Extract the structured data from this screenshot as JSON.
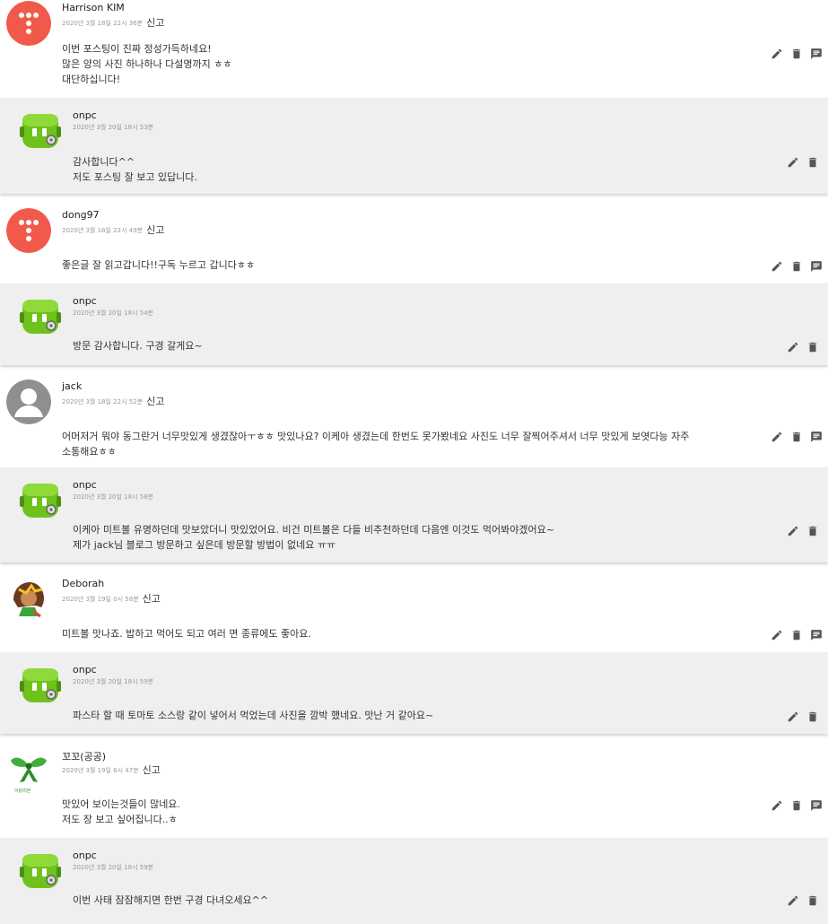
{
  "labels": {
    "report": "신고"
  },
  "threads": [
    {
      "comment": {
        "author": "Harrison KIM",
        "date": "2020년 3월 18일 22시 36분",
        "lines": [
          "이번 포스팅이 진짜 정성가득하네요!",
          "많은 양의 사진 하나하나 다설명까지 ㅎㅎ",
          "대단하십니다!"
        ],
        "avatar": "tistory-logo-avatar"
      },
      "reply": {
        "author": "onpc",
        "date": "2020년 3월 20일 18시 53분",
        "lines": [
          "감사합니다^^",
          "저도 포스팅 잘 보고 있답니다."
        ],
        "avatar": "green-robot-avatar"
      }
    },
    {
      "comment": {
        "author": "dong97",
        "date": "2020년 3월 18일 22시 49분",
        "lines": [
          "좋은글 잘 읽고갑니다!!구독 누르고 갑니다ㅎㅎ"
        ],
        "avatar": "tistory-logo-avatar"
      },
      "reply": {
        "author": "onpc",
        "date": "2020년 3월 20일 18시 54분",
        "lines": [
          "방문 감사합니다. 구경 갈게요~"
        ],
        "avatar": "green-robot-avatar"
      }
    },
    {
      "comment": {
        "author": "jack",
        "date": "2020년 3월 18일 22시 52분",
        "lines": [
          "어머저거 뭐야 동그란거 너무맛있게 생겼잖아ㅜㅎㅎ 맛있나요? 이케아 생겼는데 한번도 못가봤네요 사진도 너무 잘찍어주셔서 너무 맛있게 보엿다능 자주",
          "소통해요ㅎㅎ"
        ],
        "avatar": "default-user-avatar"
      },
      "reply": {
        "author": "onpc",
        "date": "2020년 3월 20일 18시 58분",
        "lines": [
          "이케아 미트볼 유명하던데 맛보았더니 맛있었어요. 비건 미트볼은 다들 비추천하던데 다음엔 이것도 먹어봐야겠어요~",
          "제가 jack님 블로그 방문하고 싶은데 방문할 방법이 없네요 ㅠㅠ"
        ],
        "avatar": "green-robot-avatar"
      }
    },
    {
      "comment": {
        "author": "Deborah",
        "date": "2020년 3월 19일 0시 58분",
        "lines": [
          "미트볼 맛나죠. 밥하고 먹어도 되고 여러 면 종류에도 좋아요."
        ],
        "avatar": "cartoon-girl-avatar"
      },
      "reply": {
        "author": "onpc",
        "date": "2020년 3월 20일 18시 59분",
        "lines": [
          "파스타 할 때 토마토 소스랑 같이 넣어서 먹었는데 사진을 깜박 했네요. 맛난 거 같아요~"
        ],
        "avatar": "green-robot-avatar"
      }
    },
    {
      "comment": {
        "author": "꼬꼬(공공)",
        "date": "2020년 3월 19일 6시 47분",
        "lines": [
          "맛있어 보이는것들이 많네요.",
          "저도 장 보고 싶어집니다..ㅎ"
        ],
        "avatar": "green-ribbon-avatar",
        "avatar_caption": "아랑리본"
      },
      "reply": {
        "author": "onpc",
        "date": "2020년 3월 20일 18시 59분",
        "lines": [
          "이번 사태 잠잠해지면 한번 구경 다녀오세요^^"
        ],
        "avatar": "green-robot-avatar"
      }
    }
  ],
  "colors": {
    "reply_bg": "#efefef",
    "tistory_red": "#f15a4a",
    "robot_green": "#6fc21c",
    "icon_gray": "#555555"
  }
}
